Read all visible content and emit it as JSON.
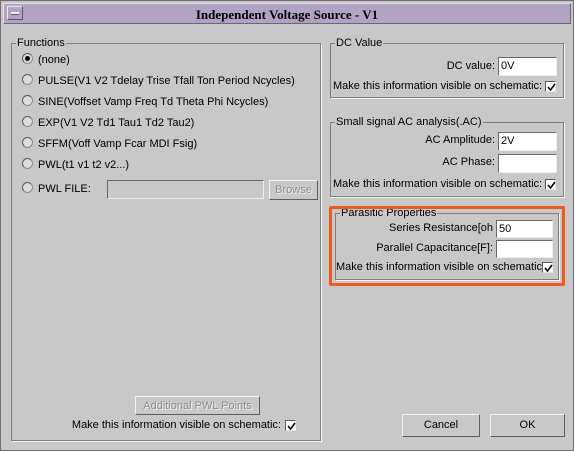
{
  "window": {
    "title": "Independent Voltage Source - V1",
    "menu_icon": "window-menu-icon"
  },
  "functions": {
    "legend": "Functions",
    "options": [
      {
        "label": "(none)",
        "selected": true
      },
      {
        "label": "PULSE(V1 V2 Tdelay Trise Tfall Ton Period Ncycles)",
        "selected": false
      },
      {
        "label": "SINE(Voffset Vamp Freq Td Theta Phi Ncycles)",
        "selected": false
      },
      {
        "label": "EXP(V1 V2 Td1 Tau1 Td2 Tau2)",
        "selected": false
      },
      {
        "label": "SFFM(Voff Vamp Fcar MDI Fsig)",
        "selected": false
      },
      {
        "label": "PWL(t1 v1 t2 v2...)",
        "selected": false
      },
      {
        "label": "PWL FILE:",
        "selected": false
      }
    ],
    "pwl_file_value": "",
    "browse_label": "Browse",
    "additional_pwl_label": "Additional PWL Points",
    "visible_label": "Make this information visible on schematic:",
    "visible_checked": true
  },
  "dc": {
    "legend": "DC Value",
    "value_label": "DC value:",
    "value": "0V",
    "visible_label": "Make this information visible on schematic:",
    "visible_checked": true
  },
  "ac": {
    "legend": "Small signal AC analysis(.AC)",
    "amplitude_label": "AC Amplitude:",
    "amplitude": "2V",
    "phase_label": "AC Phase:",
    "phase": "",
    "visible_label": "Make this information visible on schematic:",
    "visible_checked": true
  },
  "parasitic": {
    "legend": "Parasitic Properties",
    "series_label": "Series Resistance[oh",
    "series_value": "50",
    "parallel_label": "Parallel Capacitance[F]:",
    "parallel_value": "",
    "visible_label": "Make this information visible on schematic:",
    "visible_checked": true,
    "highlight_color": "#f05a1e"
  },
  "buttons": {
    "cancel": "Cancel",
    "ok": "OK"
  },
  "colors": {
    "window_bg": "#c8c8c8",
    "titlebar_bg": "#b0a4c2"
  }
}
